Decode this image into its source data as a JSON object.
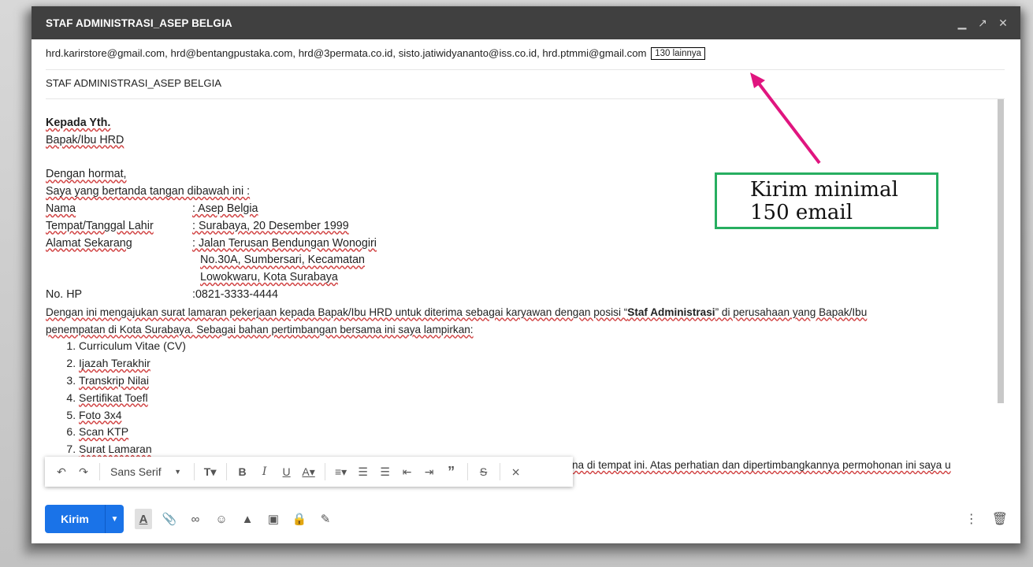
{
  "window": {
    "title": "STAF ADMINISTRASI_ASEP BELGIA",
    "controls": [
      "minimize-icon",
      "expand-icon",
      "close-icon"
    ]
  },
  "recipients": {
    "list": "hrd.karirstore@gmail.com, hrd@bentangpustaka.com, hrd@3permata.co.id, sisto.jatiwidyananto@iss.co.id, hrd.ptmmi@gmail.com",
    "more": "130 lainnya"
  },
  "subject": "STAF ADMINISTRASI_ASEP BELGIA",
  "letter": {
    "greeting1": "Kepada Yth.",
    "greeting2": "Bapak/Ibu HRD",
    "salutation": "Dengan hormat,",
    "intro": "Saya yang bertanda tangan dibawah ini :",
    "fields": {
      "nama_label": "Nama",
      "nama_value": ": Asep Belgia",
      "ttl_label": "Tempat/Tanggal Lahir",
      "ttl_value": ": Surabaya, 20 Desember 1999",
      "alamat_label": "Alamat Sekarang",
      "alamat_value1": ": Jalan Terusan Bendungan Wonogiri",
      "alamat_value2": "No.30A, Sumbersari, Kecamatan",
      "alamat_value3": "Lowokwaru, Kota Surabaya",
      "hp_label": "No. HP",
      "hp_value": ":0821-3333-4444"
    },
    "para1_a": "Dengan ini mengajukan surat lamaran pekerjaan kepada Bapak/Ibu HRD untuk diterima sebagai karyawan dengan posisi “",
    "para1_bold": "Staf Administrasi",
    "para1_b": "” di perusahaan yang Bapak/Ibu",
    "para2": "penempatan di Kota Surabaya. Sebagai bahan pertimbangan bersama ini saya lampirkan:",
    "attachments": [
      "Curriculum Vitae (CV)",
      "Ijazah Terakhir",
      "Transkrip Nilai",
      "Sertifikat Toefl",
      "Foto 3x4",
      "Scan KTP",
      "Surat Lamaran"
    ],
    "closing_fragment": "na di tempat ini. Atas perhatian dan dipertimbangkannya permohonan ini saya u"
  },
  "format_toolbar": {
    "font": "Sans Serif",
    "buttons": [
      "undo-icon",
      "redo-icon",
      "font-size-icon",
      "bold-icon",
      "italic-icon",
      "underline-icon",
      "text-color-icon",
      "align-icon",
      "numbered-list-icon",
      "bulleted-list-icon",
      "indent-less-icon",
      "indent-more-icon",
      "quote-icon",
      "strikethrough-icon",
      "remove-formatting-icon"
    ]
  },
  "bottom_toolbar": {
    "send_label": "Kirim",
    "tools": [
      "formatting-options-icon",
      "attach-file-icon",
      "insert-link-icon",
      "emoji-icon",
      "google-drive-icon",
      "insert-photo-icon",
      "confidential-mode-icon",
      "signature-icon"
    ],
    "right": [
      "more-options-icon",
      "discard-draft-icon"
    ]
  },
  "annotation": {
    "line1": "Kirim minimal",
    "line2": "150 email",
    "box_color": "#27ae60",
    "arrow_color": "#e0157f"
  },
  "colors": {
    "titlebar": "#404040",
    "send_button": "#1a73e8",
    "spell_underline": "#d04040"
  }
}
